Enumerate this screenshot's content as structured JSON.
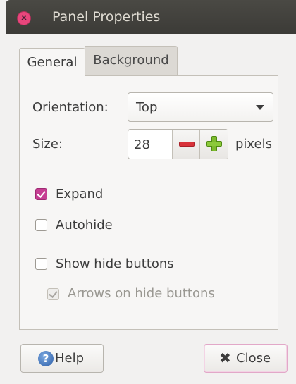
{
  "window": {
    "title": "Panel Properties",
    "close_icon_glyph": "×"
  },
  "tabs": [
    {
      "label": "General",
      "active": true
    },
    {
      "label": "Background",
      "active": false
    }
  ],
  "general": {
    "orientation_label": "Orientation:",
    "orientation_value": "Top",
    "size_label": "Size:",
    "size_value": "28",
    "size_unit": "pixels",
    "expand": {
      "label": "Expand",
      "checked": true,
      "enabled": true
    },
    "autohide": {
      "label": "Autohide",
      "checked": false,
      "enabled": true
    },
    "show_hide_buttons": {
      "label": "Show hide buttons",
      "checked": false,
      "enabled": true
    },
    "arrows_on_hide_buttons": {
      "label": "Arrows on hide buttons",
      "checked": true,
      "enabled": false
    }
  },
  "buttons": {
    "help_label": "Help",
    "help_icon_glyph": "?",
    "close_label": "Close",
    "close_icon_glyph": "✖"
  },
  "colors": {
    "titlebar": "#3c3b37",
    "accent_checkbox": "#c63e93",
    "minus": "#d8323a",
    "plus": "#7dbb2e"
  }
}
